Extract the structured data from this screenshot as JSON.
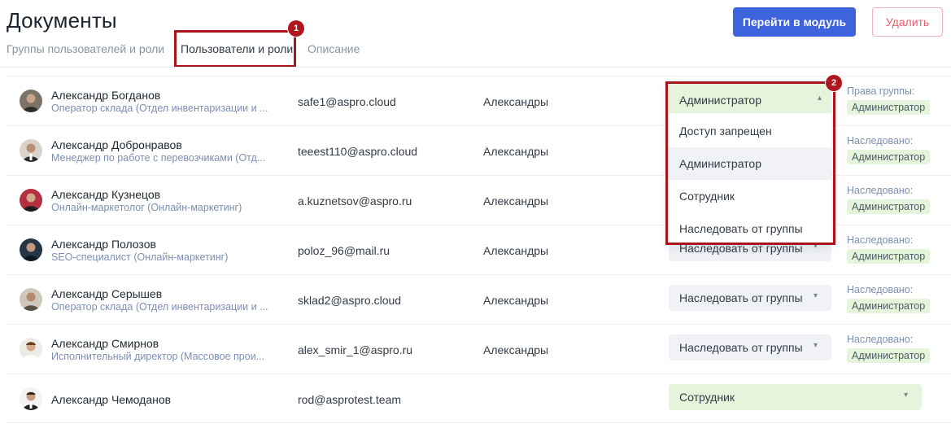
{
  "page": {
    "title": "Документы"
  },
  "tabs": [
    {
      "label": "Группы пользователей и роли"
    },
    {
      "label": "Пользователи и роли"
    },
    {
      "label": "Описание"
    }
  ],
  "toolbar": {
    "primary_label": "Перейти в модуль",
    "delete_label": "Удалить"
  },
  "markers": [
    "1",
    "2"
  ],
  "users": [
    {
      "name": "Александр Богданов",
      "position": "Оператор склада (Отдел инвентаризации и ...",
      "email": "safe1@aspro.cloud",
      "group": "Александры",
      "role": "Администратор",
      "inherit_label": "Права группы:",
      "inherit_value": "Администратор"
    },
    {
      "name": "Александр Добронравов",
      "position": "Менеджер по работе с перевозчиками (Отд...",
      "email": "teeest110@aspro.cloud",
      "group": "Александры",
      "role": "",
      "inherit_label": "Наследовано:",
      "inherit_value": "Администратор"
    },
    {
      "name": "Александр Кузнецов",
      "position": "Онлайн-маркетолог (Онлайн-маркетинг)",
      "email": "a.kuznetsov@aspro.ru",
      "group": "Александры",
      "role": "",
      "inherit_label": "Наследовано:",
      "inherit_value": "Администратор"
    },
    {
      "name": "Александр Полозов",
      "position": "SEO-специалист (Онлайн-маркетинг)",
      "email": "poloz_96@mail.ru",
      "group": "Александры",
      "role": "Наследовать от группы",
      "inherit_label": "Наследовано:",
      "inherit_value": "Администратор"
    },
    {
      "name": "Александр Серышев",
      "position": "Оператор склада (Отдел инвентаризации и ...",
      "email": "sklad2@aspro.cloud",
      "group": "Александры",
      "role": "Наследовать от группы",
      "inherit_label": "Наследовано:",
      "inherit_value": "Администратор"
    },
    {
      "name": "Александр Смирнов",
      "position": "Исполнительный директор (Массовое прои...",
      "email": "alex_smir_1@aspro.ru",
      "group": "Александры",
      "role": "Наследовать от группы",
      "inherit_label": "Наследовано:",
      "inherit_value": "Администратор"
    },
    {
      "name": "Александр Чемоданов",
      "position": "",
      "email": "rod@asprotest.team",
      "group": "",
      "role": "Сотрудник",
      "inherit_label": "",
      "inherit_value": ""
    }
  ],
  "dropdown": {
    "selected": "Администратор",
    "options": [
      "Доступ запрещен",
      "Администратор",
      "Сотрудник",
      "Наследовать от группы"
    ]
  },
  "icons": {
    "chevron_down": "chevron-down-icon",
    "chevron_up": "chevron-up-icon"
  },
  "colors": {
    "primary": "#3d63dd",
    "danger": "#e35d6a",
    "accent_green": "#e4f5dc",
    "marker": "#a9151c",
    "muted_text": "#7d8fb3"
  }
}
